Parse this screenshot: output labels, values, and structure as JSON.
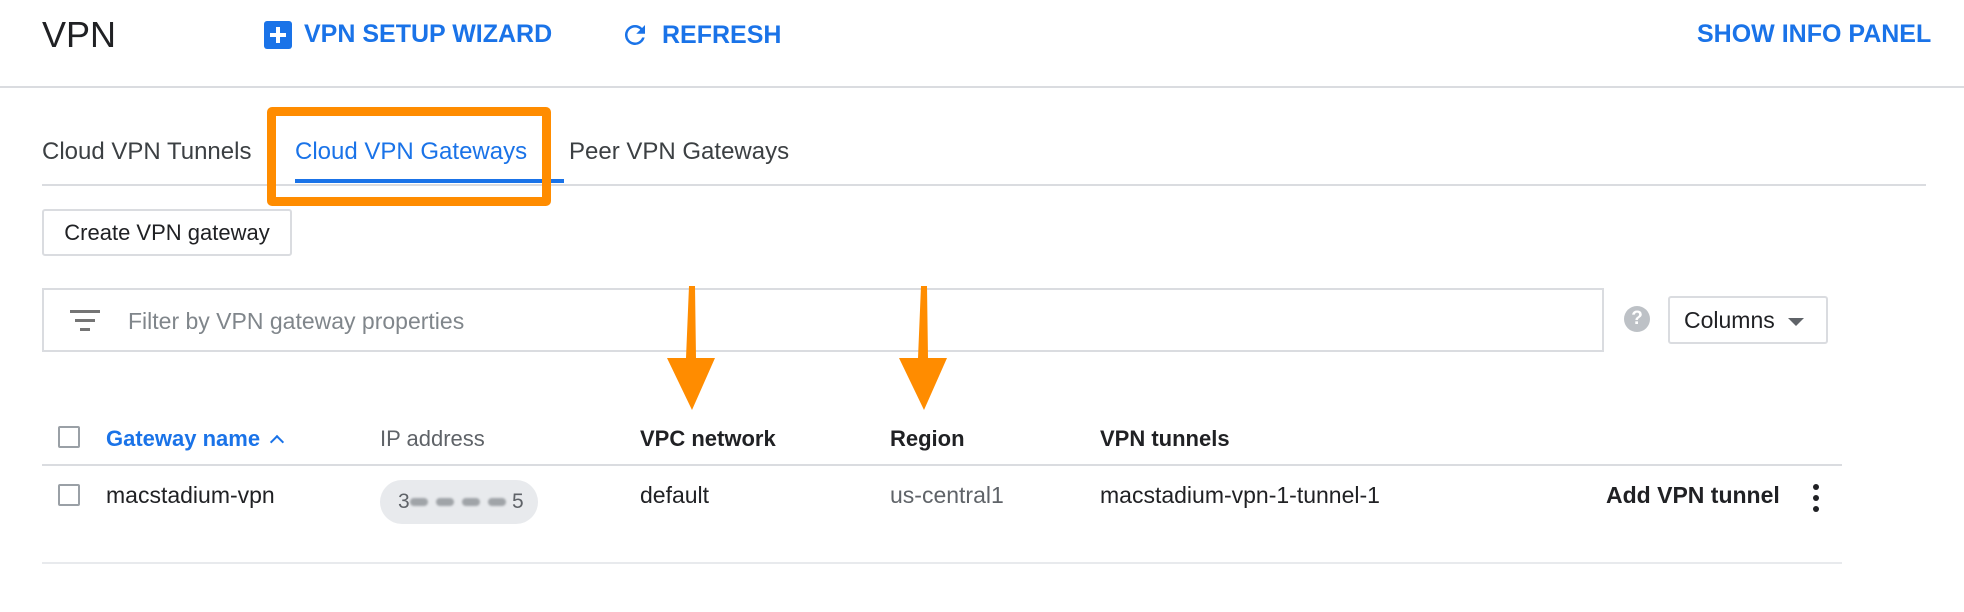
{
  "header": {
    "title": "VPN",
    "wizard_label": "VPN SETUP WIZARD",
    "refresh_label": "REFRESH",
    "info_label": "SHOW INFO PANEL"
  },
  "tabs": [
    {
      "label": "Cloud VPN Tunnels",
      "active": false
    },
    {
      "label": "Cloud VPN Gateways",
      "active": true
    },
    {
      "label": "Peer VPN Gateways",
      "active": false
    }
  ],
  "actions": {
    "create_label": "Create VPN gateway"
  },
  "filter": {
    "placeholder": "Filter by VPN gateway properties",
    "help_symbol": "?",
    "columns_label": "Columns"
  },
  "table": {
    "columns": [
      "Gateway name",
      "IP address",
      "VPC network",
      "Region",
      "VPN tunnels"
    ],
    "sort_column": "Gateway name",
    "sort_direction": "ascending",
    "rows": [
      {
        "gateway_name": "macstadium-vpn",
        "ip_address": "3",
        "ip_address_suffix": "5",
        "vpc_network": "default",
        "region": "us-central1",
        "vpn_tunnels": "macstadium-vpn-1-tunnel-1",
        "action_label": "Add VPN tunnel"
      }
    ]
  },
  "colors": {
    "accent": "#1a73e8",
    "highlight": "#ff8c00",
    "border": "#dadce0"
  },
  "icons": [
    "plus-icon",
    "refresh-icon",
    "filter-icon",
    "help-icon",
    "chevron-down-icon",
    "sort-up-icon",
    "more-vert-icon",
    "annotation-arrow-icon"
  ]
}
